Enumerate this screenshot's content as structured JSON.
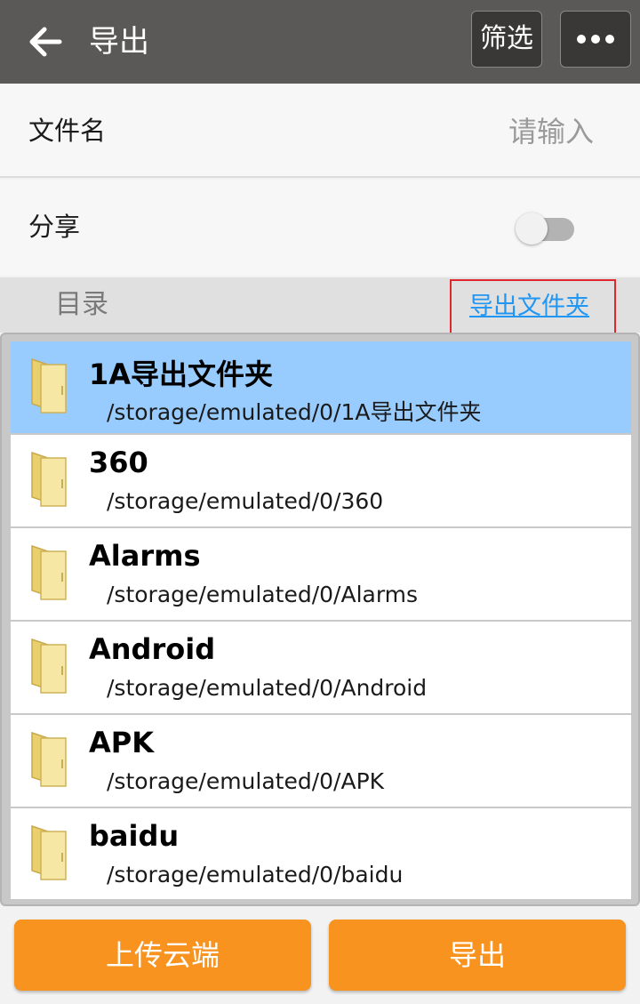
{
  "header": {
    "title": "导出",
    "back_icon": "arrow-left-icon",
    "filter_label": "筛选",
    "more_icon": "more-horizontal-icon"
  },
  "form": {
    "filename_label": "文件名",
    "filename_placeholder": "请输入",
    "filename_value": "",
    "share_label": "分享",
    "share_enabled": false
  },
  "directory": {
    "label": "目录",
    "export_folder_link": "导出文件夹"
  },
  "folders": [
    {
      "name": "1A导出文件夹",
      "path": "/storage/emulated/0/1A导出文件夹",
      "selected": true
    },
    {
      "name": "360",
      "path": "/storage/emulated/0/360",
      "selected": false
    },
    {
      "name": "Alarms",
      "path": "/storage/emulated/0/Alarms",
      "selected": false
    },
    {
      "name": "Android",
      "path": "/storage/emulated/0/Android",
      "selected": false
    },
    {
      "name": "APK",
      "path": "/storage/emulated/0/APK",
      "selected": false
    },
    {
      "name": "baidu",
      "path": "/storage/emulated/0/baidu",
      "selected": false
    }
  ],
  "actions": {
    "upload_cloud_label": "上传云端",
    "export_label": "导出"
  },
  "colors": {
    "header_bg": "#5b5957",
    "accent_orange": "#f7931e",
    "selected_row": "#98ccff",
    "link_blue": "#2196f3",
    "highlight_red": "#e0262f"
  }
}
